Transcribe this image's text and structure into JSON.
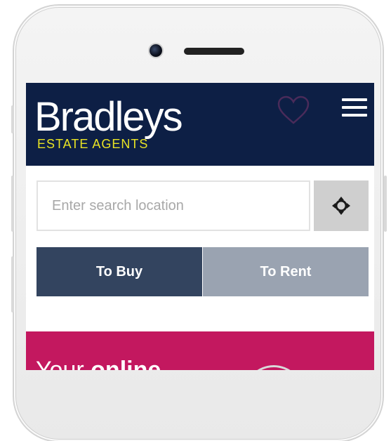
{
  "brand": {
    "name": "Bradleys",
    "tagline": "ESTATE AGENTS",
    "header_color": "#0d1f45",
    "tagline_color": "#e8e324"
  },
  "header": {
    "favorites_icon": "heart-outline-icon",
    "menu_icon": "hamburger-menu-icon"
  },
  "search": {
    "placeholder": "Enter search location",
    "value": "",
    "locate_icon": "crosshair-locate-icon"
  },
  "tabs": [
    {
      "label": "To Buy",
      "active": true
    },
    {
      "label": "To Rent",
      "active": false
    }
  ],
  "promo": {
    "text_prefix": "Your",
    "text_bold": "online",
    "color": "#c3185f"
  }
}
